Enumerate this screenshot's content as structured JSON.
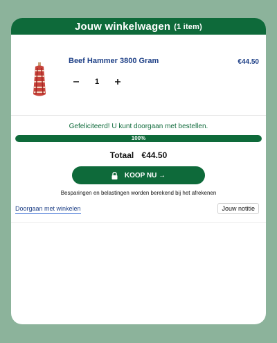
{
  "header": {
    "title": "Jouw winkelwagen",
    "count_label": "(1 item)"
  },
  "cart_item": {
    "name": "Beef Hammer 3800 Gram",
    "price": "€44.50",
    "quantity": "1",
    "decrement_icon": "minus-icon",
    "increment_icon": "plus-icon"
  },
  "progress": {
    "message": "Gefeliciteerd! U kunt doorgaan met bestellen.",
    "percent_label": "100%",
    "fill_fraction": 1.0,
    "color": "#0e6a3a"
  },
  "summary": {
    "total_label": "Totaal",
    "total_amount": "€44.50",
    "checkout_label": "KOOP NU →",
    "checkout_icon": "lock-icon",
    "tax_note": "Besparingen en belastingen worden berekend bij het afrekenen"
  },
  "footer": {
    "continue_label": "Doorgaan met winkelen",
    "note_label": "Jouw notitie"
  },
  "colors": {
    "brand_green": "#0e6a3a",
    "link_blue": "#1d3f86",
    "background": "#8cb39b"
  }
}
